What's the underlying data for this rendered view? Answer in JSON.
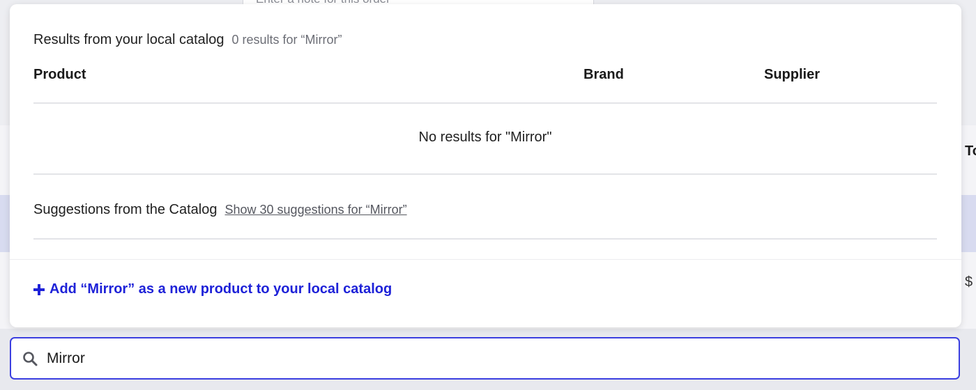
{
  "background": {
    "note_placeholder": "Enter a note for this order",
    "right_fragment_top": "To",
    "right_fragment_bottom": "$"
  },
  "local_results": {
    "title": "Results from your local catalog",
    "count_text": "0 results for “Mirror”",
    "columns": [
      "Product",
      "Brand",
      "Supplier"
    ],
    "empty_message": "No results for \"Mirror\""
  },
  "suggestions": {
    "title": "Suggestions from the Catalog",
    "link_text": "Show 30 suggestions for “Mirror”"
  },
  "add_product": {
    "label": "Add “Mirror” as a new product to your local catalog",
    "icon": "plus-icon"
  },
  "search": {
    "value": "Mirror",
    "icon": "search-icon"
  },
  "colors": {
    "accent": "#1e22d8",
    "search_border": "#3b3fe0"
  }
}
